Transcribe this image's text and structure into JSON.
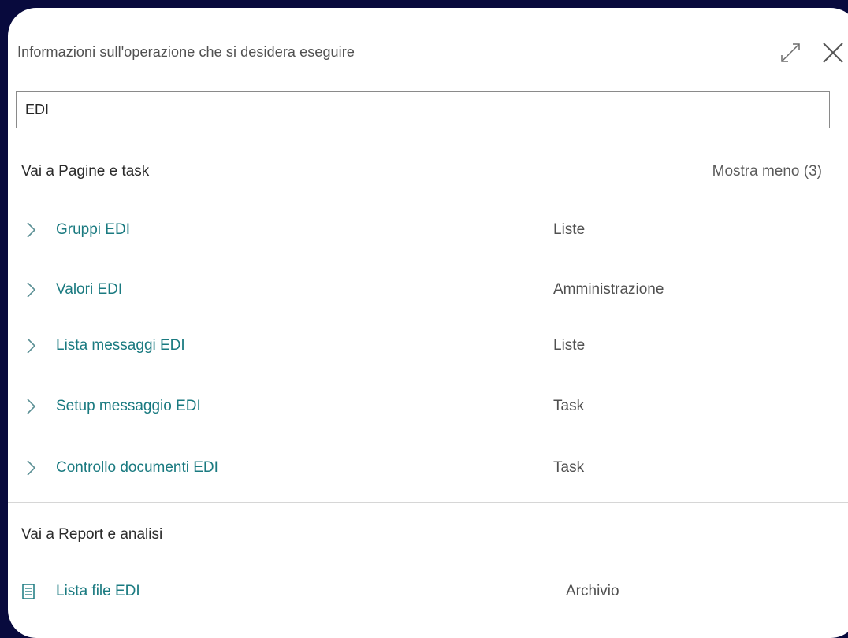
{
  "dialog": {
    "title": "Informazioni sull'operazione che si desidera eseguire",
    "expand_icon": "expand-icon",
    "close_icon": "close-icon"
  },
  "search": {
    "value": "EDI"
  },
  "pages_section": {
    "title": "Vai a Pagine e task",
    "show_less": "Mostra meno (3)",
    "items": [
      {
        "label": "Gruppi EDI",
        "category": "Liste"
      },
      {
        "label": "Valori EDI",
        "category": "Amministrazione"
      },
      {
        "label": "Lista messaggi EDI",
        "category": "Liste"
      },
      {
        "label": "Setup messaggio EDI",
        "category": "Task"
      },
      {
        "label": "Controllo documenti EDI",
        "category": "Task"
      }
    ]
  },
  "reports_section": {
    "title": "Vai a Report e analisi",
    "items": [
      {
        "label": "Lista file EDI",
        "category": "Archivio"
      }
    ]
  },
  "colors": {
    "link": "#1a7a80",
    "backdrop": "#080a3d"
  }
}
